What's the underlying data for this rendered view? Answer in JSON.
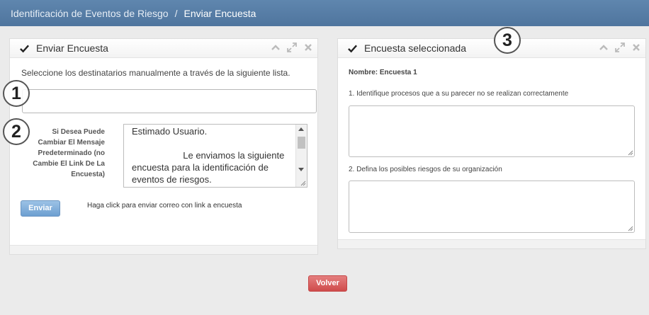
{
  "breadcrumb": {
    "parent": "Identificación de Eventos de Riesgo",
    "separator": "/",
    "current": "Enviar Encuesta"
  },
  "send_panel": {
    "title": "Enviar Encuesta",
    "description": "Seleccione los destinatarios manualmente a través de la siguiente lista.",
    "recipients_value": "",
    "message_label": "Si Desea Puede Cambiar El Mensaje Predeterminado (no Cambie El Link De La Encuesta)",
    "message_text": "Estimado Usuario.\n\n                    Le enviamos la siguiente encuesta para la identificación de eventos de riesgos.",
    "send_button": "Enviar",
    "help_text": "Haga click para enviar correo con link a encuesta"
  },
  "survey_panel": {
    "title": "Encuesta seleccionada",
    "survey_name": "Nombre: Encuesta 1",
    "questions": [
      {
        "label": "1. Identifique procesos que a su parecer no se realizan correctamente"
      },
      {
        "label": "2. Defina los posibles riesgos de su organización"
      }
    ]
  },
  "back_button": "Volver",
  "markers": [
    "1",
    "2",
    "3"
  ],
  "icons": {
    "panel_header": [
      "check-icon",
      "collapse-icon",
      "fullscreen-icon",
      "close-icon"
    ]
  },
  "colors": {
    "topbar": "#5378a0",
    "send_button": "#6d9fd1",
    "back_button": "#d9534f"
  }
}
